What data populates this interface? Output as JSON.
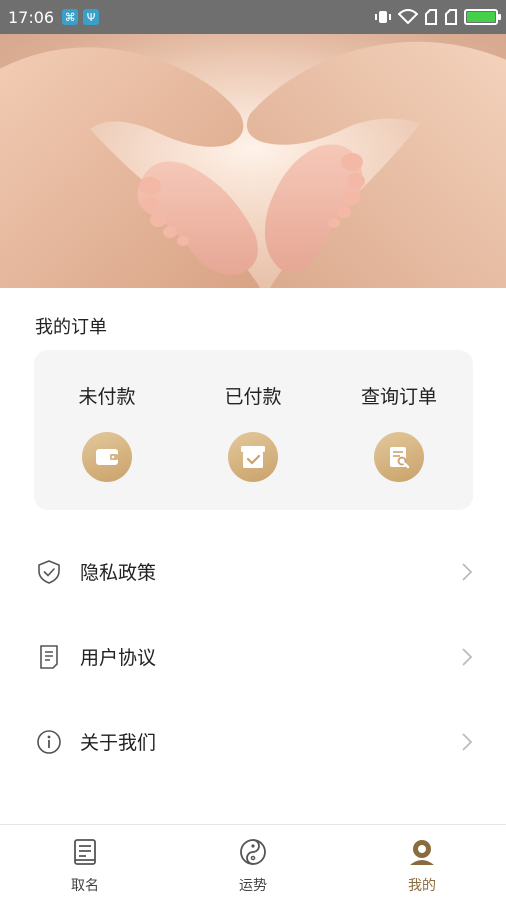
{
  "status_bar": {
    "time": "17:06"
  },
  "orders": {
    "title": "我的订单",
    "items": [
      {
        "label": "未付款",
        "icon": "wallet-icon"
      },
      {
        "label": "已付款",
        "icon": "paid-box-icon"
      },
      {
        "label": "查询订单",
        "icon": "search-order-icon"
      }
    ]
  },
  "menu": [
    {
      "label": "隐私政策",
      "icon": "shield-check-icon"
    },
    {
      "label": "用户协议",
      "icon": "document-icon"
    },
    {
      "label": "关于我们",
      "icon": "info-icon"
    }
  ],
  "tabbar": {
    "tabs": [
      {
        "label": "取名",
        "icon": "book-icon",
        "active": false
      },
      {
        "label": "运势",
        "icon": "yin-yang-icon",
        "active": false
      },
      {
        "label": "我的",
        "icon": "user-icon",
        "active": true
      }
    ]
  },
  "colors": {
    "accent_gold": "#c9a26a",
    "card_bg": "#f5f5f5",
    "status_bar": "#6f6f6f"
  }
}
